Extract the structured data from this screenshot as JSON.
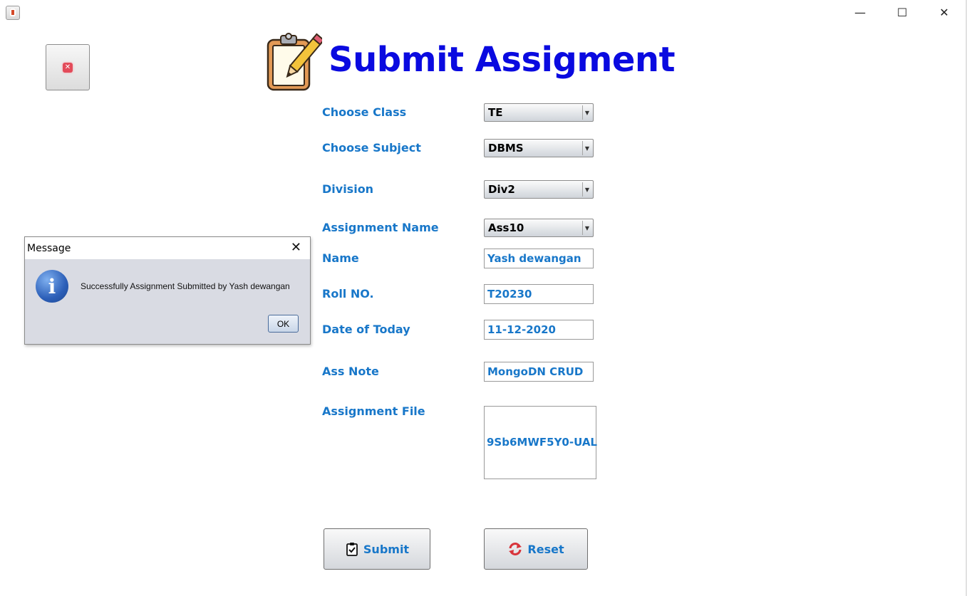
{
  "window": {
    "minimize_glyph": "—",
    "maximize_glyph": "☐",
    "close_glyph": "✕"
  },
  "page": {
    "title": "Submit Assigment"
  },
  "form": {
    "class_label": "Choose Class",
    "class_value": "TE",
    "subject_label": "Choose Subject",
    "subject_value": "DBMS",
    "division_label": "Division",
    "division_value": "Div2",
    "assignment_name_label": "Assignment Name",
    "assignment_name_value": "Ass10",
    "name_label": "Name",
    "name_value": "Yash dewangan",
    "roll_label": "Roll NO.",
    "roll_value": "T20230",
    "date_label": "Date of Today",
    "date_value": "11-12-2020",
    "note_label": "Ass Note",
    "note_value": "MongoDN CRUD",
    "file_label": "Assignment File",
    "file_value": "9Sb6MWF5Y0-UAL"
  },
  "buttons": {
    "submit_label": "Submit",
    "reset_label": "Reset"
  },
  "dialog": {
    "title": "Message",
    "close_glyph": "✕",
    "message": "Successfully Assignment Submitted by Yash dewangan",
    "ok_label": "OK"
  },
  "colors": {
    "title": "#0a0ae0",
    "label": "#1877c9",
    "dialog_bg": "#d9dbe3"
  },
  "icons": [
    "java-app-icon",
    "close-icon",
    "clipboard-pencil-icon",
    "clipboard-check-icon",
    "refresh-icon",
    "info-icon"
  ]
}
